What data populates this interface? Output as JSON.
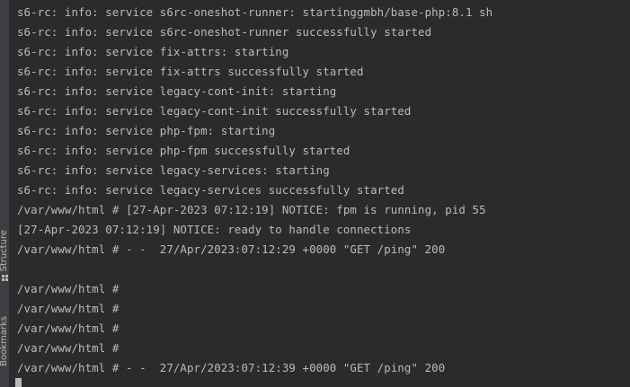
{
  "side_panel": {
    "structure_label": "Structure",
    "bookmarks_label": "Bookmarks"
  },
  "terminal": {
    "lines": [
      "s6-rc: info: service s6rc-oneshot-runner: startinggmbh/base-php:8.1 sh",
      "s6-rc: info: service s6rc-oneshot-runner successfully started",
      "s6-rc: info: service fix-attrs: starting",
      "s6-rc: info: service fix-attrs successfully started",
      "s6-rc: info: service legacy-cont-init: starting",
      "s6-rc: info: service legacy-cont-init successfully started",
      "s6-rc: info: service php-fpm: starting",
      "s6-rc: info: service php-fpm successfully started",
      "s6-rc: info: service legacy-services: starting",
      "s6-rc: info: service legacy-services successfully started",
      "/var/www/html # [27-Apr-2023 07:12:19] NOTICE: fpm is running, pid 55",
      "[27-Apr-2023 07:12:19] NOTICE: ready to handle connections",
      "/var/www/html # - -  27/Apr/2023:07:12:29 +0000 \"GET /ping\" 200",
      "",
      "/var/www/html #",
      "/var/www/html #",
      "/var/www/html #",
      "/var/www/html #",
      "/var/www/html # - -  27/Apr/2023:07:12:39 +0000 \"GET /ping\" 200"
    ]
  },
  "colors": {
    "background": "#2b2b2b",
    "text": "#bbbbbb",
    "side_panel": "#3c3f41"
  },
  "icons": {
    "structure": "structure-icon",
    "bookmarks": "bookmark-icon",
    "cursor": "block-cursor"
  }
}
